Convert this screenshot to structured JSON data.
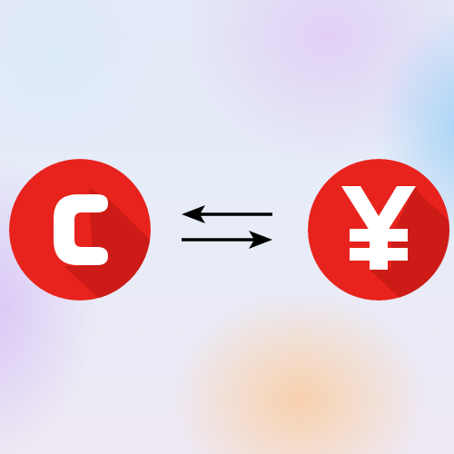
{
  "left_coin": {
    "icon": "csc-coin-icon",
    "glyph": "C",
    "color": "#e8231d"
  },
  "swap": {
    "icon": "swap-arrows-icon",
    "color": "#000000"
  },
  "right_coin": {
    "icon": "yen-coin-icon",
    "glyph": "¥",
    "color": "#e8231d"
  }
}
